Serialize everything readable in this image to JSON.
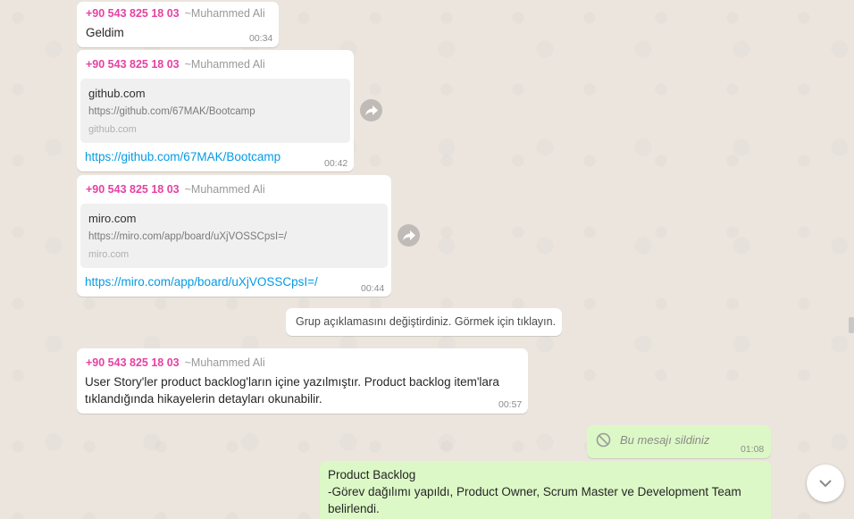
{
  "messages": [
    {
      "phone": "+90 543 825 18 03",
      "sender": "~Muhammed Ali",
      "text": "Geldim",
      "time": "00:34"
    },
    {
      "phone": "+90 543 825 18 03",
      "sender": "~Muhammed Ali",
      "preview_title": "github.com",
      "preview_url": "https://github.com/67MAK/Bootcamp",
      "preview_domain": "github.com",
      "link": "https://github.com/67MAK/Bootcamp",
      "time": "00:42"
    },
    {
      "phone": "+90 543 825 18 03",
      "sender": "~Muhammed Ali",
      "preview_title": "miro.com",
      "preview_url": "https://miro.com/app/board/uXjVOSSCpsI=/",
      "preview_domain": "miro.com",
      "link": "https://miro.com/app/board/uXjVOSSCpsI=/",
      "time": "00:44"
    },
    {
      "phone": "+90 543 825 18 03",
      "sender": "~Muhammed Ali",
      "text_line1": "User Story'ler product backlog'ların içine yazılmıştır. Product backlog item'lara",
      "text_line2": "tıklandığında hikayelerin detayları okunabilir.",
      "time": "00:57"
    }
  ],
  "system": {
    "text": "Grup açıklamasını değiştirdiniz. Görmek için tıklayın."
  },
  "deleted": {
    "text": "Bu mesajı sildiniz",
    "time": "01:08"
  },
  "outgoing": {
    "line1": "Product Backlog",
    "line2": "-Görev dağılımı yapıldı, Product Owner, Scrum Master ve Development Team",
    "line3": "belirlendi."
  },
  "icons": {
    "forward": "forward-icon",
    "scroll": "chevron-down-icon",
    "deleted": "blocked-icon"
  },
  "colors": {
    "sender_phone": "#e542a3",
    "link": "#039be5",
    "outgoing_bubble": "#dcf8c6"
  }
}
